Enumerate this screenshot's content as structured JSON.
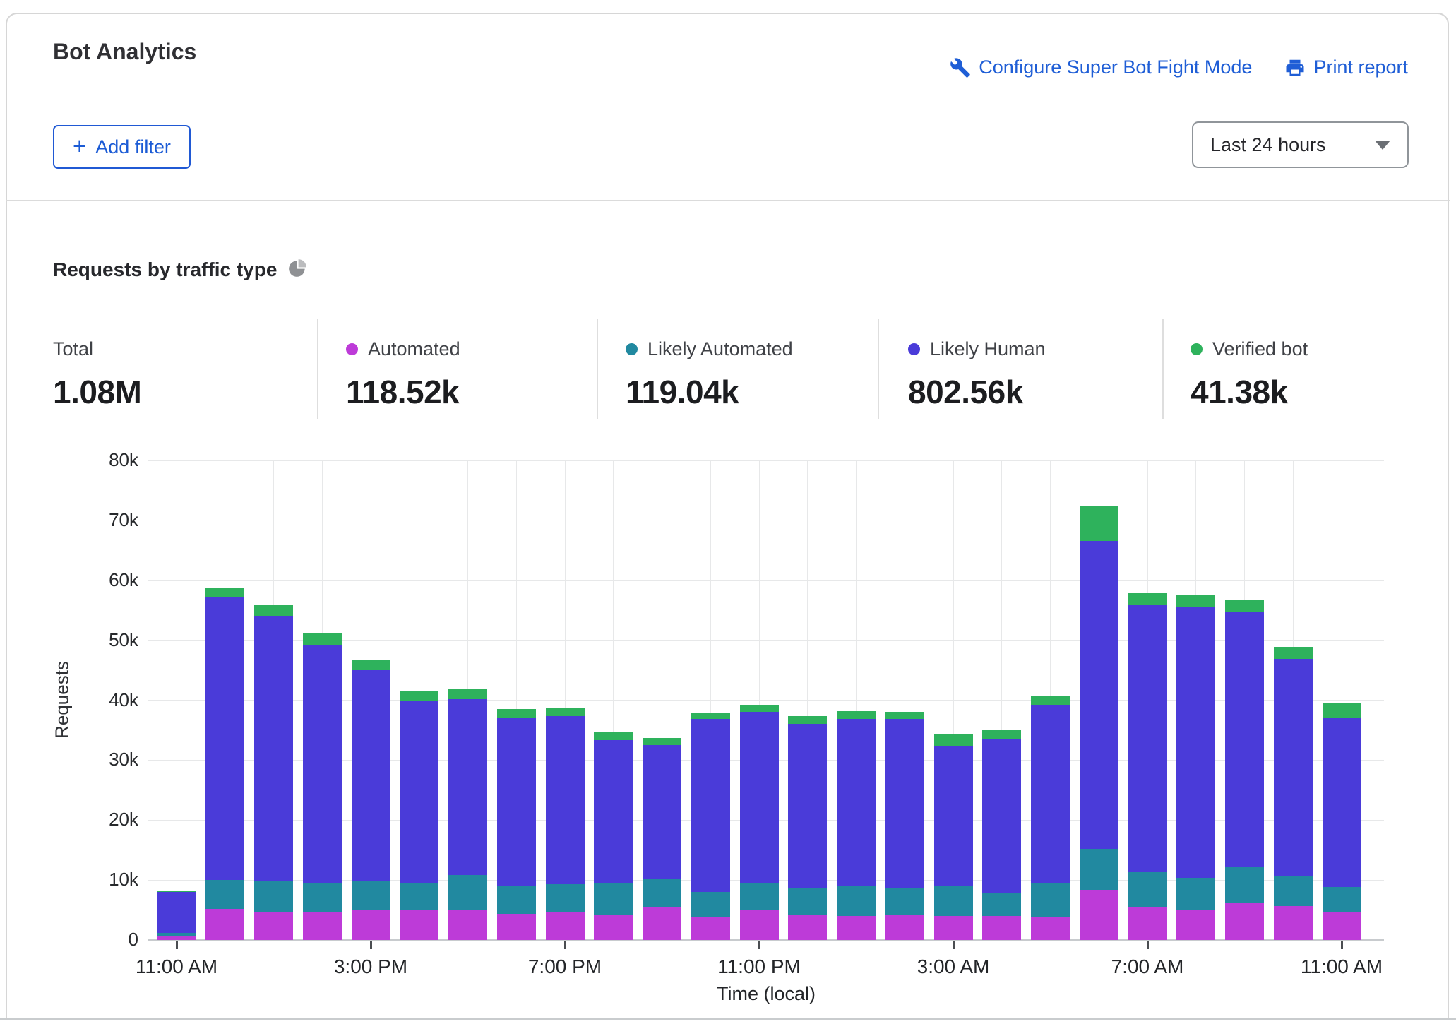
{
  "header": {
    "title": "Bot Analytics",
    "configure_link": "Configure Super Bot Fight Mode",
    "print_link": "Print report",
    "add_filter_label": "Add filter",
    "add_filter_plus": "+",
    "time_range": "Last 24 hours"
  },
  "section": {
    "title": "Requests by traffic type"
  },
  "stats": [
    {
      "label": "Total",
      "value": "1.08M",
      "color": null
    },
    {
      "label": "Automated",
      "value": "118.52k",
      "color": "#bd3bd8"
    },
    {
      "label": "Likely Automated",
      "value": "119.04k",
      "color": "#2189a0"
    },
    {
      "label": "Likely Human",
      "value": "802.56k",
      "color": "#4a3bd9"
    },
    {
      "label": "Verified bot",
      "value": "41.38k",
      "color": "#2eb25c"
    }
  ],
  "chart_data": {
    "type": "bar",
    "stacked": true,
    "title": "Requests by traffic type",
    "xlabel": "Time (local)",
    "ylabel": "Requests",
    "ylim": [
      0,
      80000
    ],
    "grid": true,
    "y_tick_labels": [
      "0",
      "10k",
      "20k",
      "30k",
      "40k",
      "50k",
      "60k",
      "70k",
      "80k"
    ],
    "x_tick_labels": [
      "11:00 AM",
      "3:00 PM",
      "7:00 PM",
      "11:00 PM",
      "3:00 AM",
      "7:00 AM",
      "11:00 AM"
    ],
    "x_tick_positions": [
      0,
      4,
      8,
      12,
      16,
      20,
      24
    ],
    "series": [
      {
        "name": "Automated",
        "color": "#bd3bd8",
        "values": [
          600,
          5200,
          4700,
          4600,
          5100,
          5000,
          4900,
          4400,
          4700,
          4250,
          5500,
          3850,
          4900,
          4250,
          4050,
          4100,
          3950,
          3950,
          3850,
          8400,
          5500,
          5100,
          6300,
          5700,
          4750
        ]
      },
      {
        "name": "Likely Automated",
        "color": "#2189a0",
        "values": [
          600,
          4850,
          5050,
          4950,
          4800,
          4400,
          6000,
          4700,
          4650,
          5150,
          4600,
          4150,
          4650,
          4500,
          4950,
          4500,
          5000,
          3900,
          5700,
          6800,
          5800,
          5300,
          5900,
          5000,
          4050
        ]
      },
      {
        "name": "Likely Human",
        "color": "#4a3bd9",
        "values": [
          6800,
          47250,
          44350,
          39750,
          35100,
          30500,
          29300,
          27900,
          27950,
          23900,
          22400,
          28900,
          28550,
          27250,
          27900,
          28300,
          23450,
          25650,
          29650,
          51400,
          44600,
          45100,
          42500,
          36200,
          28200
        ]
      },
      {
        "name": "Verified bot",
        "color": "#2eb25c",
        "values": [
          300,
          1500,
          1700,
          1900,
          1600,
          1600,
          1700,
          1500,
          1500,
          1300,
          1200,
          1000,
          1100,
          1300,
          1300,
          1200,
          1900,
          1500,
          1400,
          5900,
          2100,
          2100,
          2000,
          2000,
          2500
        ]
      }
    ]
  }
}
